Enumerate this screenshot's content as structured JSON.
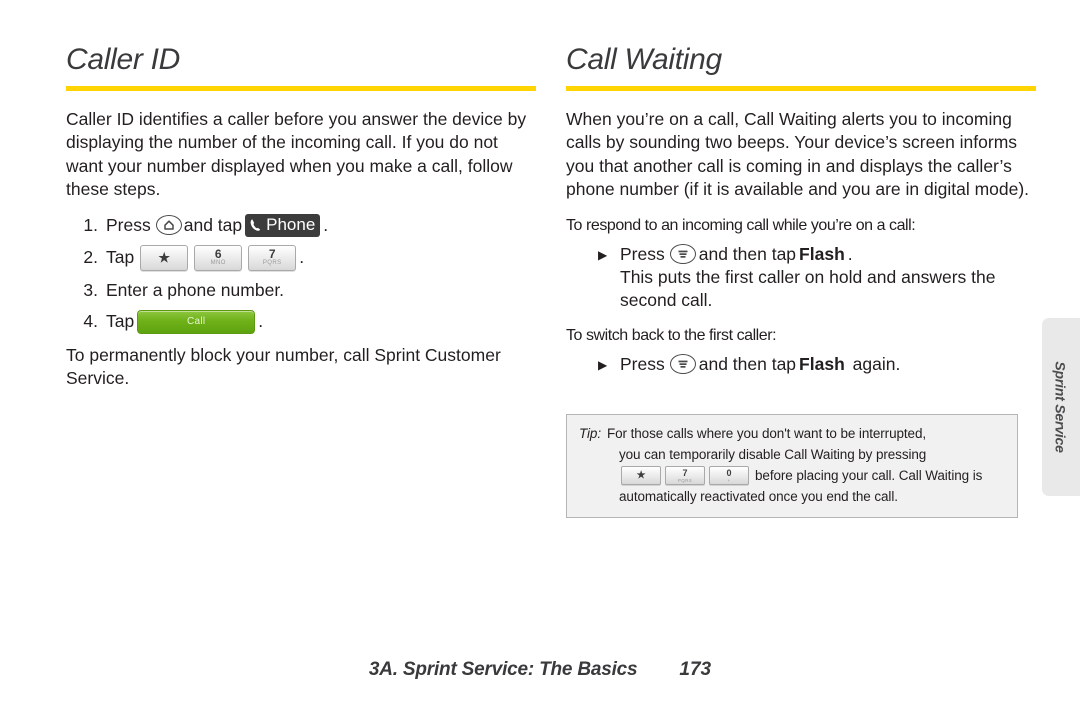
{
  "left_column": {
    "title": "Caller ID",
    "intro": "Caller ID identifies a caller before you answer the device by displaying the number of the incoming call. If you do not want your number displayed when you make a call, follow these steps.",
    "steps": [
      {
        "num": "1.",
        "pre": "Press",
        "key_icon": "home-key-icon",
        "mid": "and tap",
        "button": {
          "icon": "phone-handset-icon",
          "label": "Phone"
        },
        "post": "."
      },
      {
        "num": "2.",
        "pre": "Tap",
        "keys": [
          {
            "main": "★",
            "sub": ""
          },
          {
            "main": "6",
            "sub": "MNO"
          },
          {
            "main": "7",
            "sub": "PQRS"
          }
        ],
        "post": "."
      },
      {
        "num": "3.",
        "pre": "Enter a phone number.",
        "post": ""
      },
      {
        "num": "4.",
        "pre": "Tap",
        "call_button": "Call",
        "post": "."
      }
    ],
    "outro": "To permanently block your number, call Sprint Customer Service."
  },
  "right_column": {
    "title": "Call Waiting",
    "intro": "When you’re on a call, Call Waiting alerts you to incoming calls by sounding two beeps. Your device’s screen informs you that another call is coming in and displays the caller’s phone number (if it is available and you are in digital mode).",
    "sections": [
      {
        "heading": "To respond to an incoming call while you’re on a call:",
        "bullet": {
          "marker": "▶",
          "pre": "Press",
          "key_icon": "menu-key-icon",
          "mid": "and then tap",
          "bold": "Flash",
          "post": ".",
          "extra": "This puts the first caller on hold and answers the second call."
        }
      },
      {
        "heading": "To switch back to the first caller:",
        "bullet": {
          "marker": "▶",
          "pre": "Press",
          "key_icon": "menu-key-icon",
          "mid": "and then tap",
          "bold": "Flash",
          "post": " again.",
          "extra": ""
        }
      }
    ]
  },
  "tip": {
    "label": "Tip:",
    "line1": "For those calls where you don't want to be interrupted,",
    "line2": "you can temporarily disable Call Waiting by pressing",
    "keys": [
      {
        "main": "★",
        "sub": ""
      },
      {
        "main": "7",
        "sub": "PQRS"
      },
      {
        "main": "0",
        "sub": "+"
      }
    ],
    "line3_after_keys": "before placing your call. Call Waiting is",
    "line4": "automatically reactivated once you end the call."
  },
  "side_tab": {
    "label": "Sprint Service"
  },
  "footer": {
    "title": "3A. Sprint Service: The Basics",
    "page": "173"
  },
  "colors": {
    "rule_yellow": "#ffd400",
    "heading_gray": "#3a3a3c",
    "body_black": "#231f20",
    "phone_button_bg": "#3c3c3c",
    "call_button_green": "#6fb118",
    "tip_bg": "#f1f1f1",
    "side_tab_bg": "#e9e9e9"
  }
}
